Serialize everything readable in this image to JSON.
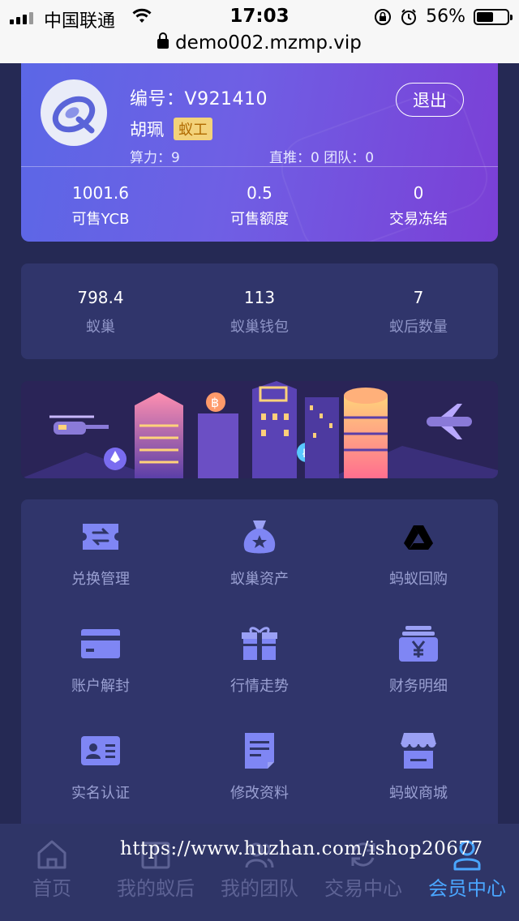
{
  "status_bar": {
    "carrier": "中国联通",
    "time": "17:03",
    "battery": "56%",
    "battery_level": 0.56,
    "url": "demo002.mzmp.vip"
  },
  "profile": {
    "id_label": "编号：",
    "id_value": "V921410",
    "name": "胡珮",
    "role": "蚁工",
    "power_label": "算力：",
    "power_value": "9",
    "direct_label": "直推：",
    "direct_value": "0",
    "team_label": "团队：",
    "team_value": "0",
    "logout": "退出",
    "metrics": [
      {
        "value": "1001.6",
        "label": "可售YCB"
      },
      {
        "value": "0.5",
        "label": "可售额度"
      },
      {
        "value": "0",
        "label": "交易冻结"
      }
    ]
  },
  "nest_stats": [
    {
      "value": "798.4",
      "label": "蚁巢"
    },
    {
      "value": "113",
      "label": "蚁巢钱包"
    },
    {
      "value": "7",
      "label": "蚁后数量"
    }
  ],
  "menu": [
    {
      "label": "兑换管理",
      "icon": "exchange-ticket-icon"
    },
    {
      "label": "蚁巢资产",
      "icon": "money-bag-icon"
    },
    {
      "label": "蚂蚁回购",
      "icon": "google-drive-icon"
    },
    {
      "label": "账户解封",
      "icon": "credit-card-icon"
    },
    {
      "label": "行情走势",
      "icon": "gift-box-icon"
    },
    {
      "label": "财务明细",
      "icon": "yen-wallet-icon"
    },
    {
      "label": "实名认证",
      "icon": "id-card-icon"
    },
    {
      "label": "修改资料",
      "icon": "document-edit-icon"
    },
    {
      "label": "蚂蚁商城",
      "icon": "shop-awning-icon"
    }
  ],
  "tabs": [
    {
      "label": "首页",
      "icon": "home-icon",
      "active": false
    },
    {
      "label": "我的蚁后",
      "icon": "book-icon",
      "active": false
    },
    {
      "label": "我的团队",
      "icon": "team-icon",
      "active": false
    },
    {
      "label": "交易中心",
      "icon": "refresh-icon",
      "active": false
    },
    {
      "label": "会员中心",
      "icon": "user-icon",
      "active": true
    }
  ],
  "watermark": "https://www.huzhan.com/ishop20677",
  "colors": {
    "background": "#252954",
    "card": "#30356b",
    "accent": "#4aa6ff",
    "badge": "#f3d27a"
  }
}
